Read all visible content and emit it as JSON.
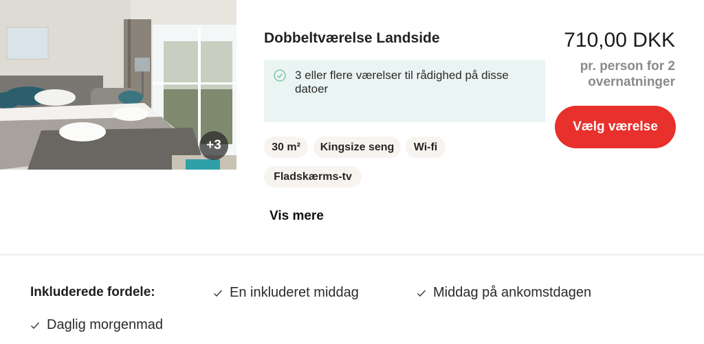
{
  "room": {
    "title": "Dobbeltværelse Landside",
    "photo_count": "+3",
    "availability": "3 eller flere værelser til rådighed på disse datoer",
    "tags": [
      "30 m²",
      "Kingsize seng",
      "Wi-fi",
      "Fladskærms-tv"
    ],
    "show_more": "Vis mere",
    "price": "710,00 DKK",
    "price_note": "pr. person for 2 overnatninger",
    "select_button": "Vælg værelse"
  },
  "benefits": {
    "label": "Inkluderede fordele:",
    "items": [
      "En inkluderet middag",
      "Middag på ankomstdagen",
      "Daglig morgenmad"
    ]
  },
  "colors": {
    "accent": "#e8302c",
    "availability_bg": "#eaf5f3",
    "check_green": "#6fbf9f",
    "tag_bg": "#f7f4ef"
  },
  "icons": [
    "check-circle-icon",
    "checkmark-icon"
  ]
}
